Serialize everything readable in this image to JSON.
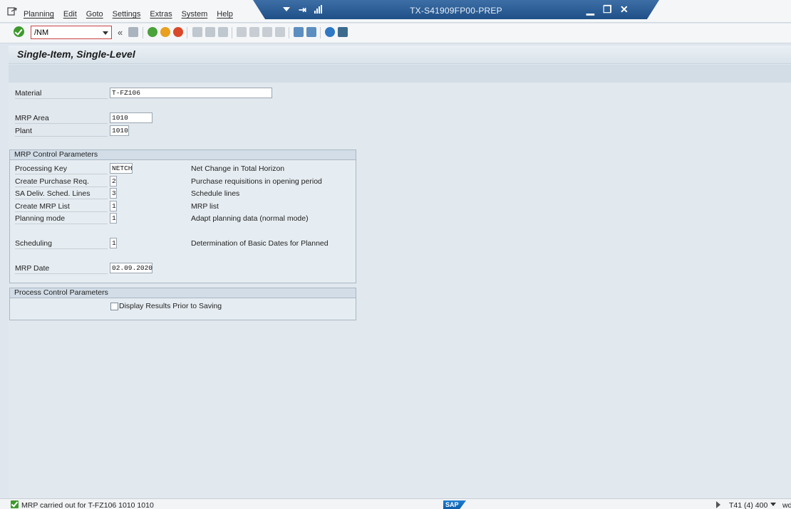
{
  "window": {
    "title": "TX-S41909FP00-PREP",
    "menu": [
      "Planning",
      "Edit",
      "Goto",
      "Settings",
      "Extras",
      "System",
      "Help"
    ],
    "minimize": "▁",
    "restore": "❐",
    "close": "✕"
  },
  "toolbar": {
    "command_value": "/NM",
    "expand_glyph": "«"
  },
  "screen": {
    "title": "Single-Item, Single-Level"
  },
  "fields": {
    "material_label": "Material",
    "material_value": "T-FZ106",
    "mrp_area_label": "MRP Area",
    "mrp_area_value": "1010",
    "plant_label": "Plant",
    "plant_value": "1010"
  },
  "mrp_control": {
    "title": "MRP Control Parameters",
    "rows": [
      {
        "label": "Processing Key",
        "value": "NETCH",
        "desc": "Net Change in Total Horizon"
      },
      {
        "label": "Create Purchase Req.",
        "value": "2",
        "desc": "Purchase requisitions in opening period"
      },
      {
        "label": "SA Deliv. Sched. Lines",
        "value": "3",
        "desc": "Schedule lines"
      },
      {
        "label": "Create MRP List",
        "value": "1",
        "desc": "MRP list"
      },
      {
        "label": "Planning mode",
        "value": "1",
        "desc": "Adapt planning data (normal mode)"
      },
      {
        "label": "Scheduling",
        "value": "1",
        "desc": "Determination of Basic Dates for Planned"
      }
    ],
    "mrp_date_label": "MRP Date",
    "mrp_date_value": "02.09.2020"
  },
  "process_control": {
    "title": "Process Control Parameters",
    "display_results_label": "Display Results Prior to Saving",
    "display_results_checked": false
  },
  "status": {
    "message": "MRP carried out for T-FZ106  1010  1010",
    "logo": "SAP",
    "system": "T41 (4) 400",
    "host": "wd"
  },
  "colors": {
    "titlebar": "#1f4f86",
    "success": "#3f9a2d",
    "background": "#dfe6ee"
  }
}
